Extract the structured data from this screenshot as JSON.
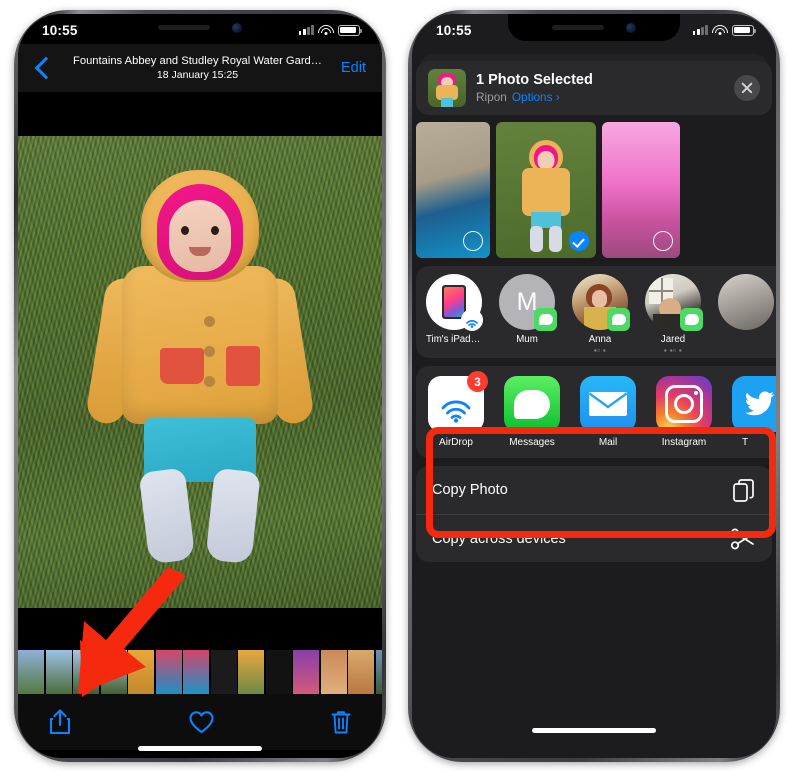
{
  "left_phone": {
    "status_bar": {
      "time": "10:55",
      "cellular_icon": "signal-bars-icon",
      "wifi_icon": "wifi-icon",
      "battery_icon": "battery-icon"
    },
    "nav": {
      "back_icon": "back-chevron-icon",
      "title": "Fountains Abbey and Studley Royal Water Gard…",
      "subtitle": "18 January  15:25",
      "edit_label": "Edit"
    },
    "toolbar": {
      "share_icon": "share-icon",
      "favorite_icon": "heart-icon",
      "delete_icon": "trash-icon"
    },
    "annotation": {
      "arrow_icon": "red-arrow-pointing-to-share-button",
      "color": "#f4290d"
    }
  },
  "right_phone": {
    "status_bar": {
      "time": "10:55",
      "cellular_icon": "signal-bars-icon",
      "wifi_icon": "wifi-icon",
      "battery_icon": "battery-icon"
    },
    "share_sheet": {
      "header": {
        "thumbnail": "selected-photo-thumbnail",
        "title": "1 Photo Selected",
        "location": "Ripon",
        "options_label": "Options",
        "options_chevron": "chevron-right-icon",
        "close_icon": "close-icon"
      },
      "photo_shelf": [
        {
          "name": "photo-cobblestones",
          "selected": false
        },
        {
          "name": "photo-toddler-grass",
          "selected": true
        },
        {
          "name": "photo-pink-room",
          "selected": false
        }
      ],
      "contacts": [
        {
          "name": "Tim's iPad Pro",
          "sub": "",
          "badge": "airdrop-badge-icon",
          "avatar": "ipad-avatar"
        },
        {
          "name": "Mum",
          "sub": "",
          "badge": "messages-badge-icon",
          "avatar": "initial-avatar",
          "initial": "M"
        },
        {
          "name": "Anna",
          "sub": "▪▫ ▪",
          "badge": "messages-badge-icon",
          "avatar": "photo-avatar"
        },
        {
          "name": "Jared",
          "sub": "▪ ▪▫ ▪",
          "badge": "messages-badge-icon",
          "avatar": "photo-avatar"
        }
      ],
      "apps": [
        {
          "name": "AirDrop",
          "icon": "airdrop-icon",
          "badge": "3"
        },
        {
          "name": "Messages",
          "icon": "messages-icon",
          "badge": ""
        },
        {
          "name": "Mail",
          "icon": "mail-icon",
          "badge": ""
        },
        {
          "name": "Instagram",
          "icon": "instagram-icon",
          "badge": ""
        },
        {
          "name": "T",
          "icon": "twitter-icon",
          "badge": ""
        }
      ],
      "actions": [
        {
          "label": "Copy Photo",
          "icon": "copy-icon"
        },
        {
          "label": "Copy across devices",
          "icon": "scissors-icon"
        }
      ]
    },
    "annotation": {
      "highlight_box": "red-highlight-around-contacts-row",
      "color": "#f4290d"
    }
  }
}
